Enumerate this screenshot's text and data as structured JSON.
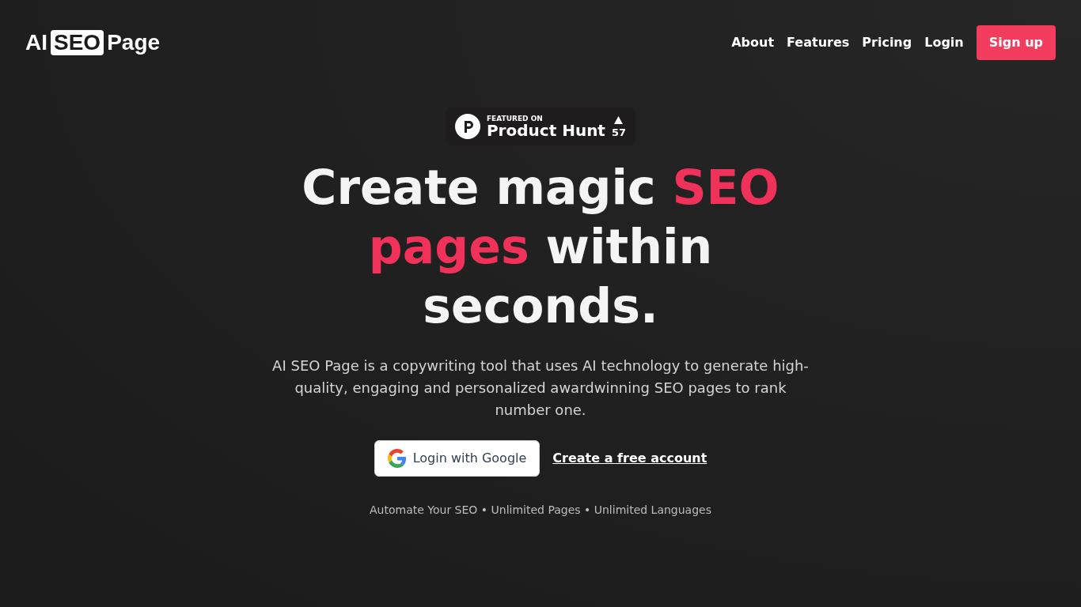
{
  "logo": {
    "parts": [
      {
        "text": "AI",
        "boxed": false
      },
      {
        "text": "SEO",
        "boxed": true
      },
      {
        "text": "Page",
        "boxed": false
      }
    ]
  },
  "nav": {
    "links": [
      "About",
      "Features",
      "Pricing",
      "Login"
    ],
    "cta": "Sign up"
  },
  "badge": {
    "kicker": "FEATURED ON",
    "name": "Product Hunt",
    "votes": "57"
  },
  "headline": [
    {
      "text": "Create magic ",
      "highlight": false
    },
    {
      "text": "SEO pages",
      "highlight": true
    },
    {
      "text": " within seconds.",
      "highlight": false
    }
  ],
  "description": "AI SEO Page is a copywriting tool that uses AI technology to generate high-quality, engaging and personalized awardwinning SEO pages to rank number one.",
  "actions": {
    "google": "Login with Google",
    "signup": "Create a free account"
  },
  "tagline": "Automate Your SEO • Unlimited Pages • Unlimited Languages"
}
